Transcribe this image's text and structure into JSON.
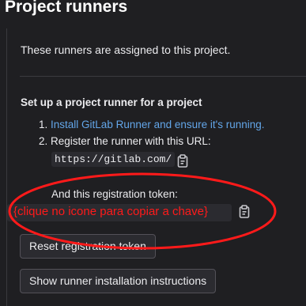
{
  "section_title": "Project runners",
  "intro_text": "These runners are assigned to this project.",
  "setup": {
    "title": "Set up a project runner for a project",
    "step1_number": "1.",
    "step1_link": "Install GitLab Runner and ensure it's running.",
    "step2_number": "2.",
    "step2_text": "Register the runner with this URL:",
    "url": "https://gitlab.com/",
    "token_label": "And this registration token:",
    "token_annotation": "{clique no icone para copiar a chave}"
  },
  "buttons": {
    "reset_token": "Reset registration token",
    "show_instructions": "Show runner installation instructions"
  },
  "colors": {
    "background": "#1f1f22",
    "link": "#63a6e9",
    "annotation_red": "#ff1a1a"
  },
  "icons": {
    "copy": "clipboard-icon"
  }
}
